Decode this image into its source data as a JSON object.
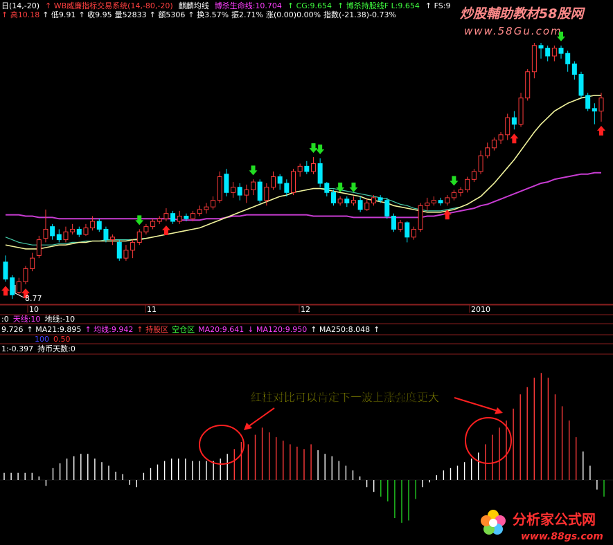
{
  "colors": {
    "background": "#000000",
    "up_candle": "#ff3b3b",
    "down_candle": "#00e8ff",
    "ma_yellow": "#f0f09a",
    "ma_green": "#46c9a8",
    "ma_purple": "#c83cd2",
    "buy_arrow": "#ff2020",
    "sell_arrow": "#22dd22",
    "hist_red": "#ff3a3a",
    "hist_white": "#ffffff",
    "hist_green": "#22cc22",
    "panel_line": "#8a1e1e",
    "annotation_text": "#ffff00",
    "circle": "#ff2020",
    "watermark": "#ff8a8a",
    "logo_text": "#ff3030"
  },
  "header": {
    "line1": [
      {
        "text": "日(14,-20)",
        "color": "#ffffff"
      },
      {
        "text": "↑ WB威廉指标交易系统(14,-80,-20)",
        "color": "#ff4040"
      },
      {
        "text": "麒麟均线",
        "color": "#ffffff"
      },
      {
        "text": "博杀生命线:10.704",
        "color": "#ff40ff"
      },
      {
        "text": "↑ CG:9.654",
        "color": "#40ff40"
      },
      {
        "text": "↑ 博杀持股线F L:9.654",
        "color": "#40ff40"
      },
      {
        "text": "↑ FS:9",
        "color": "#ffffff"
      }
    ],
    "line2": [
      {
        "text": "↑ 高10.18",
        "color": "#ff4040"
      },
      {
        "text": "↑ 低9.91",
        "color": "#ffffff"
      },
      {
        "text": "↑ 收9.95",
        "color": "#ffffff"
      },
      {
        "text": "量52833",
        "color": "#ffffff"
      },
      {
        "text": "↑ 额5306",
        "color": "#ffffff"
      },
      {
        "text": "↑ 换3.57%",
        "color": "#ffffff"
      },
      {
        "text": "振2.71%",
        "color": "#ffffff"
      },
      {
        "text": "涨(0.00)0.00%",
        "color": "#ffffff"
      },
      {
        "text": "指数(-21.38)-0.73%",
        "color": "#ffffff"
      }
    ]
  },
  "watermark": {
    "title": "炒股輔助教材58股网",
    "url": "www.58Gu.com"
  },
  "price_label": "8.77",
  "x_axis": {
    "labels": [
      "10",
      "11",
      "12",
      "2010"
    ]
  },
  "indicator_lines": {
    "row1": [
      {
        "text": ":0",
        "color": "#ffffff"
      },
      {
        "text": "天线:10",
        "color": "#ff40ff"
      },
      {
        "text": "地线:-10",
        "color": "#ffffff"
      }
    ],
    "row2": [
      {
        "text": "9.726",
        "color": "#ffffff"
      },
      {
        "text": "↑ MA21:9.895",
        "color": "#ffffff"
      },
      {
        "text": "↑ 均线:9.942",
        "color": "#ff40ff"
      },
      {
        "text": "↑ 持股区",
        "color": "#ff4040"
      },
      {
        "text": "空仓区",
        "color": "#40ff40"
      },
      {
        "text": "MA20:9.641",
        "color": "#ff40ff"
      },
      {
        "text": "↓ MA120:9.950",
        "color": "#ff40ff"
      },
      {
        "text": "↑ MA250:8.048",
        "color": "#ffffff"
      },
      {
        "text": "↑",
        "color": "#ffffff"
      }
    ],
    "row3": [
      {
        "text": "100",
        "color": "#4444ff"
      },
      {
        "text": "0.50",
        "color": "#ff3030"
      }
    ],
    "row4": [
      {
        "text": "1:-0.397",
        "color": "#ffffff"
      },
      {
        "text": "持币天数:0",
        "color": "#ffffff"
      }
    ]
  },
  "annotation": {
    "text": "红柱对比可以肯定下一波上涨强度更大"
  },
  "logo": {
    "name": "分析家公式网",
    "url": "www.88gs.com"
  },
  "chart_data": {
    "type": "candlestick",
    "candles": [
      {
        "o": 9.05,
        "c": 8.92,
        "h": 9.1,
        "l": 8.9
      },
      {
        "o": 8.93,
        "c": 8.8,
        "h": 8.95,
        "l": 8.77
      },
      {
        "o": 8.82,
        "c": 8.9,
        "h": 8.93,
        "l": 8.8
      },
      {
        "o": 8.9,
        "c": 9.0,
        "h": 9.02,
        "l": 8.88
      },
      {
        "o": 9.0,
        "c": 9.08,
        "h": 9.12,
        "l": 8.98
      },
      {
        "o": 9.1,
        "c": 9.22,
        "h": 9.25,
        "l": 9.08
      },
      {
        "o": 9.23,
        "c": 9.3,
        "h": 9.45,
        "l": 9.2
      },
      {
        "o": 9.32,
        "c": 9.25,
        "h": 9.34,
        "l": 9.22
      },
      {
        "o": 9.26,
        "c": 9.22,
        "h": 9.3,
        "l": 9.2
      },
      {
        "o": 9.22,
        "c": 9.28,
        "h": 9.32,
        "l": 9.2
      },
      {
        "o": 9.28,
        "c": 9.3,
        "h": 9.34,
        "l": 9.26
      },
      {
        "o": 9.3,
        "c": 9.26,
        "h": 9.32,
        "l": 9.24
      },
      {
        "o": 9.26,
        "c": 9.31,
        "h": 9.34,
        "l": 9.25
      },
      {
        "o": 9.31,
        "c": 9.36,
        "h": 9.4,
        "l": 9.29
      },
      {
        "o": 9.36,
        "c": 9.3,
        "h": 9.38,
        "l": 9.28
      },
      {
        "o": 9.3,
        "c": 9.22,
        "h": 9.32,
        "l": 9.2
      },
      {
        "o": 9.22,
        "c": 9.24,
        "h": 9.26,
        "l": 9.18
      },
      {
        "o": 9.2,
        "c": 9.08,
        "h": 9.22,
        "l": 9.06
      },
      {
        "o": 9.08,
        "c": 9.14,
        "h": 9.18,
        "l": 9.06
      },
      {
        "o": 9.14,
        "c": 9.2,
        "h": 9.22,
        "l": 9.08
      },
      {
        "o": 9.2,
        "c": 9.28,
        "h": 9.3,
        "l": 9.18
      },
      {
        "o": 9.28,
        "c": 9.32,
        "h": 9.34,
        "l": 9.26
      },
      {
        "o": 9.32,
        "c": 9.36,
        "h": 9.38,
        "l": 9.3
      },
      {
        "o": 9.36,
        "c": 9.38,
        "h": 9.4,
        "l": 9.34
      },
      {
        "o": 9.38,
        "c": 9.42,
        "h": 9.46,
        "l": 9.36
      },
      {
        "o": 9.42,
        "c": 9.36,
        "h": 9.44,
        "l": 9.34
      },
      {
        "o": 9.36,
        "c": 9.4,
        "h": 9.44,
        "l": 9.34
      },
      {
        "o": 9.4,
        "c": 9.38,
        "h": 9.42,
        "l": 9.36
      },
      {
        "o": 9.38,
        "c": 9.42,
        "h": 9.44,
        "l": 9.36
      },
      {
        "o": 9.42,
        "c": 9.45,
        "h": 9.48,
        "l": 9.4
      },
      {
        "o": 9.45,
        "c": 9.47,
        "h": 9.5,
        "l": 9.42
      },
      {
        "o": 9.47,
        "c": 9.52,
        "h": 9.55,
        "l": 9.45
      },
      {
        "o": 9.52,
        "c": 9.7,
        "h": 9.74,
        "l": 9.5
      },
      {
        "o": 9.72,
        "c": 9.58,
        "h": 9.76,
        "l": 9.55
      },
      {
        "o": 9.58,
        "c": 9.62,
        "h": 9.66,
        "l": 9.54
      },
      {
        "o": 9.62,
        "c": 9.56,
        "h": 9.65,
        "l": 9.52
      },
      {
        "o": 9.56,
        "c": 9.6,
        "h": 9.64,
        "l": 9.5
      },
      {
        "o": 9.6,
        "c": 9.66,
        "h": 9.68,
        "l": 9.56
      },
      {
        "o": 9.66,
        "c": 9.52,
        "h": 9.68,
        "l": 9.5
      },
      {
        "o": 9.52,
        "c": 9.62,
        "h": 9.65,
        "l": 9.48
      },
      {
        "o": 9.62,
        "c": 9.7,
        "h": 9.74,
        "l": 9.6
      },
      {
        "o": 9.7,
        "c": 9.65,
        "h": 9.72,
        "l": 9.6
      },
      {
        "o": 9.65,
        "c": 9.58,
        "h": 9.68,
        "l": 9.55
      },
      {
        "o": 9.58,
        "c": 9.74,
        "h": 9.76,
        "l": 9.56
      },
      {
        "o": 9.74,
        "c": 9.78,
        "h": 9.8,
        "l": 9.7
      },
      {
        "o": 9.78,
        "c": 9.74,
        "h": 9.82,
        "l": 9.72
      },
      {
        "o": 9.74,
        "c": 9.8,
        "h": 9.85,
        "l": 9.72
      },
      {
        "o": 9.8,
        "c": 9.65,
        "h": 9.84,
        "l": 9.62
      },
      {
        "o": 9.65,
        "c": 9.58,
        "h": 9.66,
        "l": 9.55
      },
      {
        "o": 9.58,
        "c": 9.5,
        "h": 9.6,
        "l": 9.48
      },
      {
        "o": 9.5,
        "c": 9.53,
        "h": 9.55,
        "l": 9.48
      },
      {
        "o": 9.53,
        "c": 9.5,
        "h": 9.55,
        "l": 9.47
      },
      {
        "o": 9.5,
        "c": 9.52,
        "h": 9.55,
        "l": 9.48
      },
      {
        "o": 9.52,
        "c": 9.45,
        "h": 9.55,
        "l": 9.43
      },
      {
        "o": 9.45,
        "c": 9.5,
        "h": 9.53,
        "l": 9.44
      },
      {
        "o": 9.5,
        "c": 9.54,
        "h": 9.56,
        "l": 9.48
      },
      {
        "o": 9.54,
        "c": 9.52,
        "h": 9.56,
        "l": 9.5
      },
      {
        "o": 9.52,
        "c": 9.4,
        "h": 9.54,
        "l": 9.38
      },
      {
        "o": 9.4,
        "c": 9.3,
        "h": 9.42,
        "l": 9.28
      },
      {
        "o": 9.3,
        "c": 9.35,
        "h": 9.37,
        "l": 9.28
      },
      {
        "o": 9.35,
        "c": 9.24,
        "h": 9.36,
        "l": 9.2
      },
      {
        "o": 9.24,
        "c": 9.3,
        "h": 9.32,
        "l": 9.22
      },
      {
        "o": 9.3,
        "c": 9.48,
        "h": 9.5,
        "l": 9.28
      },
      {
        "o": 9.48,
        "c": 9.5,
        "h": 9.54,
        "l": 9.44
      },
      {
        "o": 9.5,
        "c": 9.52,
        "h": 9.55,
        "l": 9.48
      },
      {
        "o": 9.52,
        "c": 9.5,
        "h": 9.54,
        "l": 9.48
      },
      {
        "o": 9.5,
        "c": 9.54,
        "h": 9.56,
        "l": 9.48
      },
      {
        "o": 9.54,
        "c": 9.58,
        "h": 9.6,
        "l": 9.52
      },
      {
        "o": 9.58,
        "c": 9.6,
        "h": 9.62,
        "l": 9.55
      },
      {
        "o": 9.6,
        "c": 9.68,
        "h": 9.7,
        "l": 9.58
      },
      {
        "o": 9.68,
        "c": 9.74,
        "h": 9.76,
        "l": 9.66
      },
      {
        "o": 9.74,
        "c": 9.86,
        "h": 9.9,
        "l": 9.72
      },
      {
        "o": 9.86,
        "c": 9.92,
        "h": 9.96,
        "l": 9.84
      },
      {
        "o": 9.92,
        "c": 9.98,
        "h": 10.0,
        "l": 9.9
      },
      {
        "o": 9.98,
        "c": 10.02,
        "h": 10.04,
        "l": 9.95
      },
      {
        "o": 10.02,
        "c": 10.15,
        "h": 10.18,
        "l": 9.98
      },
      {
        "o": 10.15,
        "c": 10.1,
        "h": 10.2,
        "l": 10.06
      },
      {
        "o": 10.1,
        "c": 10.3,
        "h": 10.34,
        "l": 10.08
      },
      {
        "o": 10.3,
        "c": 10.5,
        "h": 10.52,
        "l": 10.28
      },
      {
        "o": 10.5,
        "c": 10.7,
        "h": 10.72,
        "l": 10.45
      },
      {
        "o": 10.7,
        "c": 10.68,
        "h": 10.72,
        "l": 10.6
      },
      {
        "o": 10.68,
        "c": 10.62,
        "h": 10.7,
        "l": 10.58
      },
      {
        "o": 10.62,
        "c": 10.68,
        "h": 10.7,
        "l": 10.58
      },
      {
        "o": 10.68,
        "c": 10.64,
        "h": 10.7,
        "l": 10.6
      },
      {
        "o": 10.64,
        "c": 10.56,
        "h": 10.66,
        "l": 10.5
      },
      {
        "o": 10.56,
        "c": 10.48,
        "h": 10.58,
        "l": 10.44
      },
      {
        "o": 10.48,
        "c": 10.32,
        "h": 10.5,
        "l": 10.3
      },
      {
        "o": 10.32,
        "c": 10.22,
        "h": 10.34,
        "l": 10.2
      },
      {
        "o": 10.22,
        "c": 10.2,
        "h": 10.26,
        "l": 10.1
      },
      {
        "o": 10.2,
        "c": 10.3,
        "h": 10.34,
        "l": 10.12
      }
    ],
    "ma_yellow": [
      9.18,
      9.17,
      9.16,
      9.15,
      9.15,
      9.15,
      9.16,
      9.17,
      9.18,
      9.18,
      9.19,
      9.2,
      9.2,
      9.21,
      9.21,
      9.21,
      9.21,
      9.21,
      9.21,
      9.22,
      9.22,
      9.23,
      9.24,
      9.25,
      9.26,
      9.27,
      9.28,
      9.29,
      9.3,
      9.31,
      9.33,
      9.35,
      9.37,
      9.39,
      9.41,
      9.43,
      9.45,
      9.47,
      9.49,
      9.51,
      9.53,
      9.55,
      9.56,
      9.58,
      9.59,
      9.6,
      9.61,
      9.61,
      9.6,
      9.59,
      9.58,
      9.57,
      9.56,
      9.55,
      9.53,
      9.52,
      9.51,
      9.5,
      9.48,
      9.47,
      9.46,
      9.45,
      9.44,
      9.43,
      9.43,
      9.43,
      9.44,
      9.45,
      9.47,
      9.49,
      9.52,
      9.55,
      9.6,
      9.65,
      9.71,
      9.77,
      9.83,
      9.9,
      9.97,
      10.04,
      10.1,
      10.15,
      10.2,
      10.23,
      10.26,
      10.28,
      10.3,
      10.31,
      10.32,
      10.32
    ],
    "ma_green": [
      9.24,
      9.22,
      9.2,
      9.19,
      9.18,
      9.18,
      9.18,
      9.18,
      9.19,
      9.19,
      9.2,
      9.2,
      9.21,
      9.21,
      9.21,
      9.22,
      9.22,
      9.22,
      9.22,
      9.22,
      9.23,
      9.23,
      9.24,
      9.25,
      9.26,
      9.27,
      9.28,
      9.29,
      9.3,
      9.31,
      9.33,
      9.35,
      9.37,
      9.39,
      9.41,
      9.43,
      9.45,
      9.47,
      9.49,
      9.51,
      9.53,
      9.55,
      9.56,
      9.58,
      9.59,
      9.6,
      9.61,
      9.61,
      9.61,
      9.61,
      9.6,
      9.59,
      9.58,
      9.57,
      9.56,
      9.55,
      9.54,
      9.53,
      9.51,
      9.49,
      9.48,
      9.46,
      9.45,
      9.44,
      9.44,
      9.44,
      9.45,
      9.46,
      9.47,
      9.49,
      9.52,
      9.55,
      9.6,
      9.65,
      9.71,
      9.77,
      9.83,
      9.9,
      9.97,
      10.04,
      10.1,
      10.15,
      10.2,
      10.23,
      10.26,
      10.28,
      10.3,
      10.31,
      10.32,
      10.32
    ],
    "ma_purple": [
      9.41,
      9.41,
      9.41,
      9.4,
      9.4,
      9.39,
      9.39,
      9.39,
      9.38,
      9.38,
      9.38,
      9.38,
      9.38,
      9.38,
      9.38,
      9.38,
      9.38,
      9.38,
      9.38,
      9.38,
      9.38,
      9.38,
      9.38,
      9.38,
      9.38,
      9.38,
      9.37,
      9.37,
      9.37,
      9.37,
      9.38,
      9.38,
      9.38,
      9.39,
      9.4,
      9.4,
      9.41,
      9.41,
      9.41,
      9.41,
      9.41,
      9.41,
      9.41,
      9.41,
      9.41,
      9.41,
      9.4,
      9.4,
      9.4,
      9.4,
      9.4,
      9.4,
      9.39,
      9.39,
      9.39,
      9.39,
      9.39,
      9.39,
      9.39,
      9.39,
      9.39,
      9.39,
      9.39,
      9.4,
      9.4,
      9.41,
      9.42,
      9.43,
      9.44,
      9.45,
      9.46,
      9.48,
      9.49,
      9.51,
      9.53,
      9.55,
      9.57,
      9.59,
      9.61,
      9.63,
      9.65,
      9.66,
      9.68,
      9.69,
      9.7,
      9.71,
      9.72,
      9.72,
      9.73,
      9.73
    ],
    "sell_signals": [
      20,
      37,
      46,
      47,
      50,
      52,
      67,
      83
    ],
    "buy_signals": [
      0,
      3,
      24,
      66,
      76,
      89
    ],
    "histogram": [
      0.06,
      0.06,
      0.06,
      0.06,
      0.06,
      0.03,
      -0.05,
      0.1,
      0.14,
      0.18,
      0.2,
      0.22,
      0.22,
      0.18,
      0.15,
      0.12,
      0.07,
      0.05,
      -0.04,
      -0.06,
      0.06,
      0.1,
      0.13,
      0.16,
      0.18,
      0.18,
      0.18,
      0.16,
      0.16,
      0.16,
      0.16,
      0.18,
      0.22,
      0.26,
      0.32,
      0.3,
      0.38,
      0.44,
      0.4,
      0.36,
      0.33,
      0.3,
      0.28,
      0.26,
      0.3,
      0.25,
      0.22,
      0.2,
      0.16,
      0.12,
      0.08,
      0.03,
      -0.06,
      -0.1,
      -0.14,
      -0.18,
      -0.32,
      -0.36,
      -0.34,
      -0.16,
      -0.06,
      -0.02,
      0.04,
      0.08,
      0.1,
      0.12,
      0.15,
      0.18,
      0.23,
      0.3,
      0.38,
      0.44,
      0.5,
      0.6,
      0.72,
      0.78,
      0.86,
      0.9,
      0.86,
      0.72,
      0.62,
      0.5,
      0.36,
      0.24,
      0.12,
      -0.08,
      -0.14
    ]
  }
}
